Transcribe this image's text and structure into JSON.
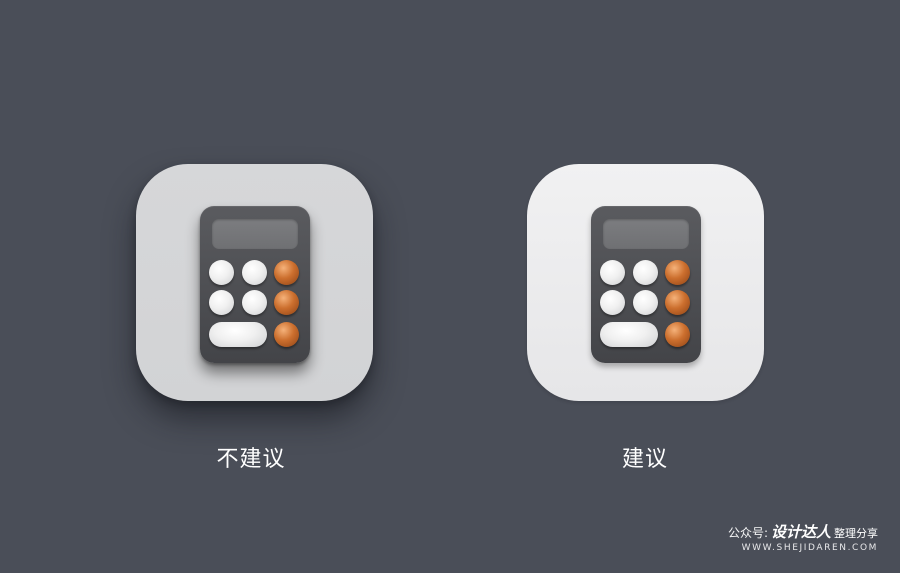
{
  "background_color": "#4a4e58",
  "panels": [
    {
      "label": "不建议",
      "tile_color": "#d5d6d8"
    },
    {
      "label": "建议",
      "tile_color": "#eeeeef"
    }
  ],
  "calculator": {
    "body_color": "#4e4f53",
    "screen_color": "#76777a",
    "key_white_color": "#f0f0f0",
    "key_orange_color": "#c8692a"
  },
  "watermark": {
    "prefix": "公众号:",
    "brand": "设计达人",
    "suffix": "整理分享",
    "url": "WWW.SHEJIDAREN.COM"
  }
}
